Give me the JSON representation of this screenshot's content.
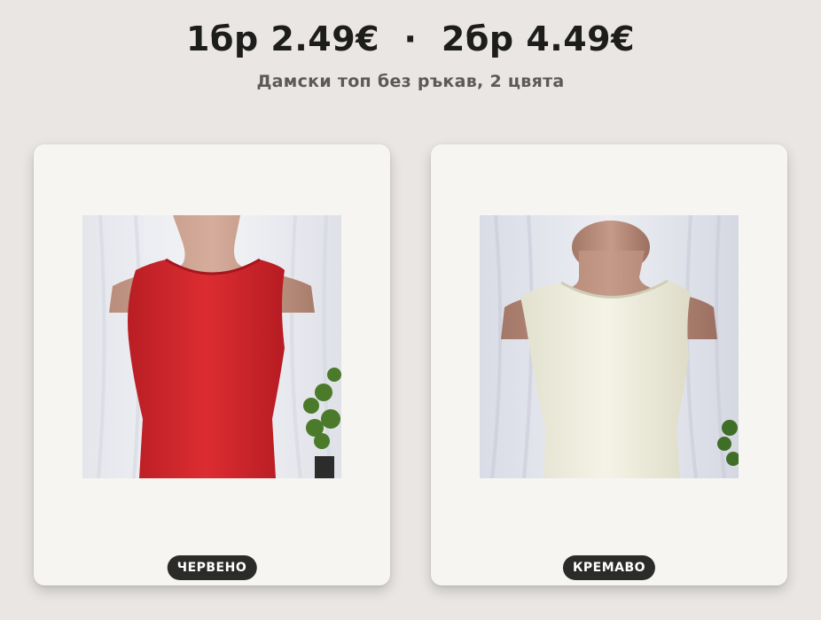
{
  "header": {
    "price_line": "1бр 2.49€  ·  2бр 4.49€",
    "subtitle": "Дамски топ без ръкав, 2 цвята"
  },
  "products": [
    {
      "color_label": "ЧЕРВЕНО",
      "icon": "red-tank-top-photo",
      "color": "#d3282d"
    },
    {
      "color_label": "КРЕМАВО",
      "icon": "cream-tank-top-photo",
      "color": "#efeee0"
    }
  ]
}
